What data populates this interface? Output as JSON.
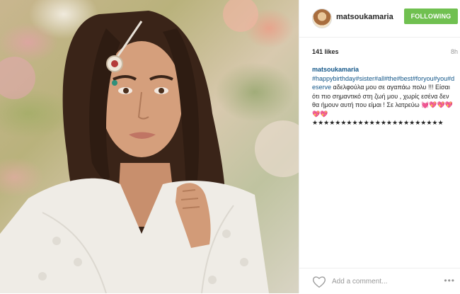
{
  "post": {
    "photo_alt": "portrait photo"
  },
  "header": {
    "username": "matsoukamaria",
    "follow_label": "FOLLOWING"
  },
  "stats": {
    "likes": "141 likes",
    "time": "8h"
  },
  "caption": {
    "username": "matsoukamaria",
    "hashtags": "#happybirthday#sister#all#the#best#foryou#you#deserve",
    "text": "αδελφούλα μου σε αγαπάω πολυ !!! Είσαι ότι πιο σημαντικό στη ζωή μου , χωρίς εσένα δεν θα ήμουν αυτή που είμαι ! Σε λατρεύω 💓💖💖💖💖💖★★★★★★★★★★★★★★★★★★★★★★★"
  },
  "footer": {
    "comment_placeholder": "Add a comment...",
    "more_label": "•••"
  },
  "colors": {
    "follow_green": "#70c050",
    "link_blue": "#125688"
  }
}
